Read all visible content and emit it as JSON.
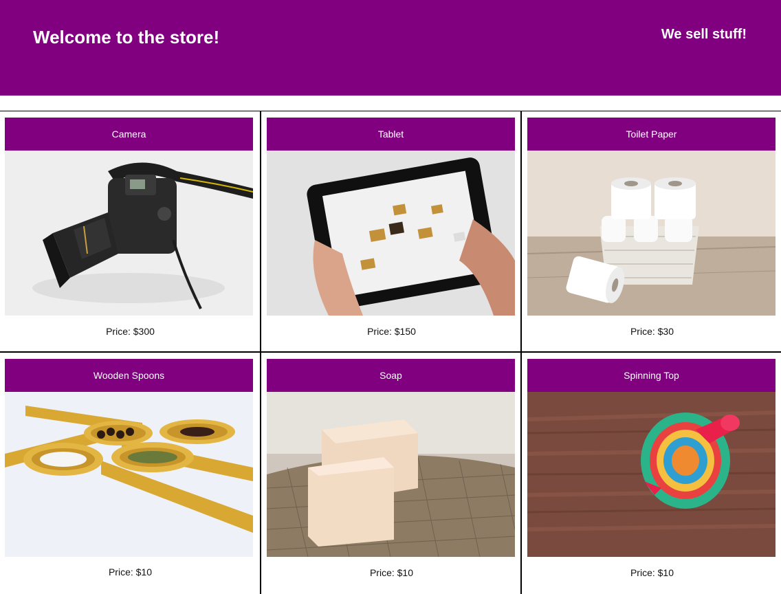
{
  "header": {
    "title": "Welcome to the store!",
    "tagline": "We sell stuff!"
  },
  "colors": {
    "brand": "#800080",
    "text_on_brand": "#ffffff"
  },
  "products": [
    {
      "name": "Camera",
      "price": "Price: $300",
      "image": "camera-photo"
    },
    {
      "name": "Tablet",
      "price": "Price: $150",
      "image": "tablet-photo"
    },
    {
      "name": "Toilet Paper",
      "price": "Price: $30",
      "image": "toilet-paper-photo"
    },
    {
      "name": "Wooden Spoons",
      "price": "Price: $10",
      "image": "wooden-spoons-photo"
    },
    {
      "name": "Soap",
      "price": "Price: $10",
      "image": "soap-photo"
    },
    {
      "name": "Spinning Top",
      "price": "Price: $10",
      "image": "spinning-top-photo"
    }
  ]
}
